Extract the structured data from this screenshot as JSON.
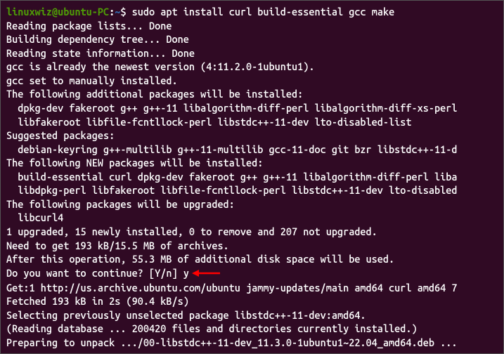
{
  "prompt": {
    "user": "linuxwiz@ubuntu-PC",
    "colon": ":",
    "path": "~",
    "dollar": "$ ",
    "command": "sudo apt install curl build-essential gcc make"
  },
  "lines": [
    "Reading package lists... Done",
    "Building dependency tree... Done",
    "Reading state information... Done",
    "gcc is already the newest version (4:11.2.0-1ubuntu1).",
    "gcc set to manually installed.",
    "The following additional packages will be installed:",
    "  dpkg-dev fakeroot g++ g++-11 libalgorithm-diff-perl libalgorithm-diff-xs-perl",
    "  libfakeroot libfile-fcntllock-perl libstdc++-11-dev lto-disabled-list",
    "Suggested packages:",
    "  debian-keyring g++-multilib g++-11-multilib gcc-11-doc git bzr libstdc++-11-d",
    "The following NEW packages will be installed:",
    "  build-essential curl dpkg-dev fakeroot g++ g++-11 libalgorithm-diff-perl liba",
    "  libdpkg-perl libfakeroot libfile-fcntllock-perl libstdc++-11-dev lto-disabled",
    "The following packages will be upgraded:",
    "  libcurl4",
    "1 upgraded, 15 newly installed, 0 to remove and 207 not upgraded.",
    "Need to get 193 kB/15.5 MB of archives.",
    "After this operation, 55.3 MB of additional disk space will be used."
  ],
  "continue_prompt": "Do you want to continue? [Y/n] ",
  "continue_answer": "y",
  "lines_after": [
    "Get:1 http://us.archive.ubuntu.com/ubuntu jammy-updates/main amd64 curl amd64 7",
    "Fetched 193 kB in 2s (90.4 kB/s)",
    "Selecting previously unselected package libstdc++-11-dev:amd64.",
    "(Reading database ... 200420 files and directories currently installed.)",
    "Preparing to unpack .../00-libstdc++-11-dev_11.3.0-1ubuntu1~22.04_amd64.deb ..."
  ]
}
